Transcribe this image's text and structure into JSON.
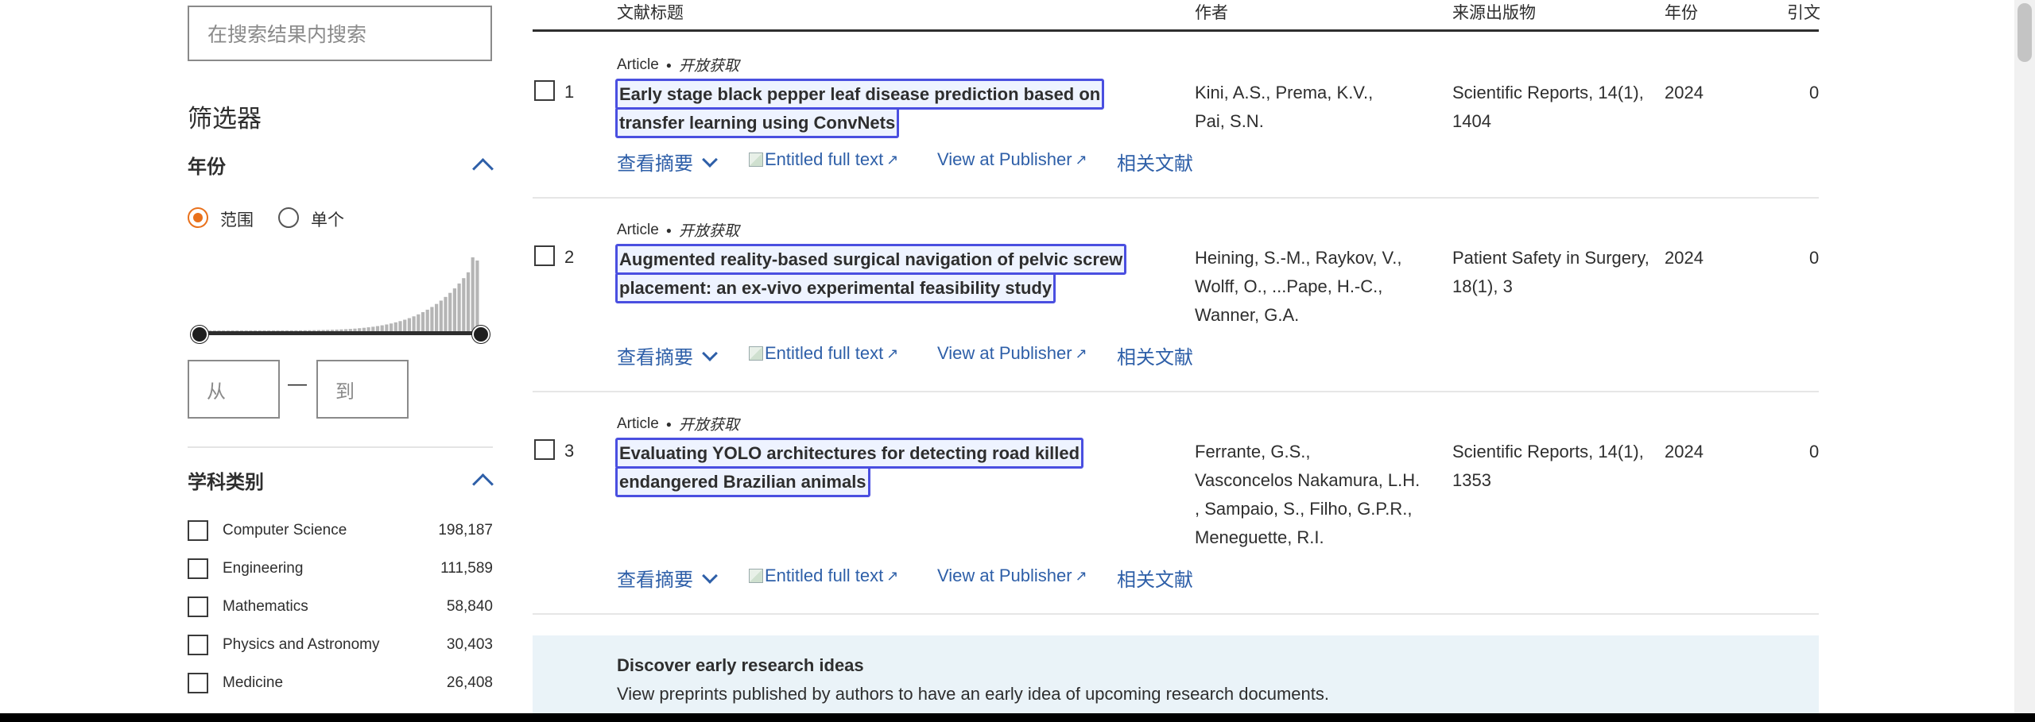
{
  "sidebar": {
    "search_placeholder": "在搜索结果内搜索",
    "filters_title": "筛选器",
    "year_section": {
      "title": "年份",
      "radio_range": "范围",
      "radio_single": "单个",
      "selected": "range",
      "from_placeholder": "从",
      "to_placeholder": "到",
      "dash": "—"
    },
    "subject_section": {
      "title": "学科类别",
      "items": [
        {
          "label": "Computer Science",
          "count": "198,187"
        },
        {
          "label": "Engineering",
          "count": "111,589"
        },
        {
          "label": "Mathematics",
          "count": "58,840"
        },
        {
          "label": "Physics and Astronomy",
          "count": "30,403"
        },
        {
          "label": "Medicine",
          "count": "26,408"
        }
      ]
    }
  },
  "table": {
    "headers": {
      "title": "文献标题",
      "authors": "作者",
      "source": "来源出版物",
      "year": "年份",
      "cited": "引文"
    },
    "rows": [
      {
        "num": "1",
        "type": "Article",
        "open_access": "开放获取",
        "title_l1": "Early stage black pepper leaf disease prediction based on",
        "title_l2": "transfer learning using ConvNets",
        "authors_l1": "Kini, A.S., Prema, K.V.,",
        "authors_l2": "Pai, S.N.",
        "authors_l3": "",
        "authors_l4": "",
        "source_l1": "Scientific Reports, 14(1),",
        "source_l2": "1404",
        "year": "2024",
        "cited": "0"
      },
      {
        "num": "2",
        "type": "Article",
        "open_access": "开放获取",
        "title_l1": "Augmented reality-based surgical navigation of pelvic screw",
        "title_l2": "placement: an ex-vivo experimental feasibility study",
        "authors_l1": "Heining, S.-M., Raykov, V.,",
        "authors_l2": "Wolff, O., ...Pape, H.-C.,",
        "authors_l3": "Wanner, G.A.",
        "authors_l4": "",
        "source_l1": "Patient Safety in Surgery,",
        "source_l2": "18(1), 3",
        "year": "2024",
        "cited": "0"
      },
      {
        "num": "3",
        "type": "Article",
        "open_access": "开放获取",
        "title_l1": "Evaluating YOLO architectures for detecting road killed",
        "title_l2": "endangered Brazilian animals",
        "authors_l1": "Ferrante, G.S.,",
        "authors_l2": "Vasconcelos Nakamura, L.H.",
        "authors_l3": ", Sampaio, S., Filho, G.P.R.,",
        "authors_l4": "Meneguette, R.I.",
        "source_l1": "Scientific Reports, 14(1),",
        "source_l2": "1353",
        "year": "2024",
        "cited": "0"
      }
    ],
    "actions": {
      "abstract": "查看摘要",
      "fulltext": "Entitled full text",
      "publisher": "View at Publisher",
      "related": "相关文献"
    }
  },
  "discover": {
    "title": "Discover early research ideas",
    "text": "View preprints published by authors to have an early idea of upcoming research documents."
  },
  "colors": {
    "accent": "#2e5fa8",
    "radio_selected": "#e9711c",
    "title_highlight": "#4a4fe0",
    "discover_bg": "#eaf3f8"
  }
}
